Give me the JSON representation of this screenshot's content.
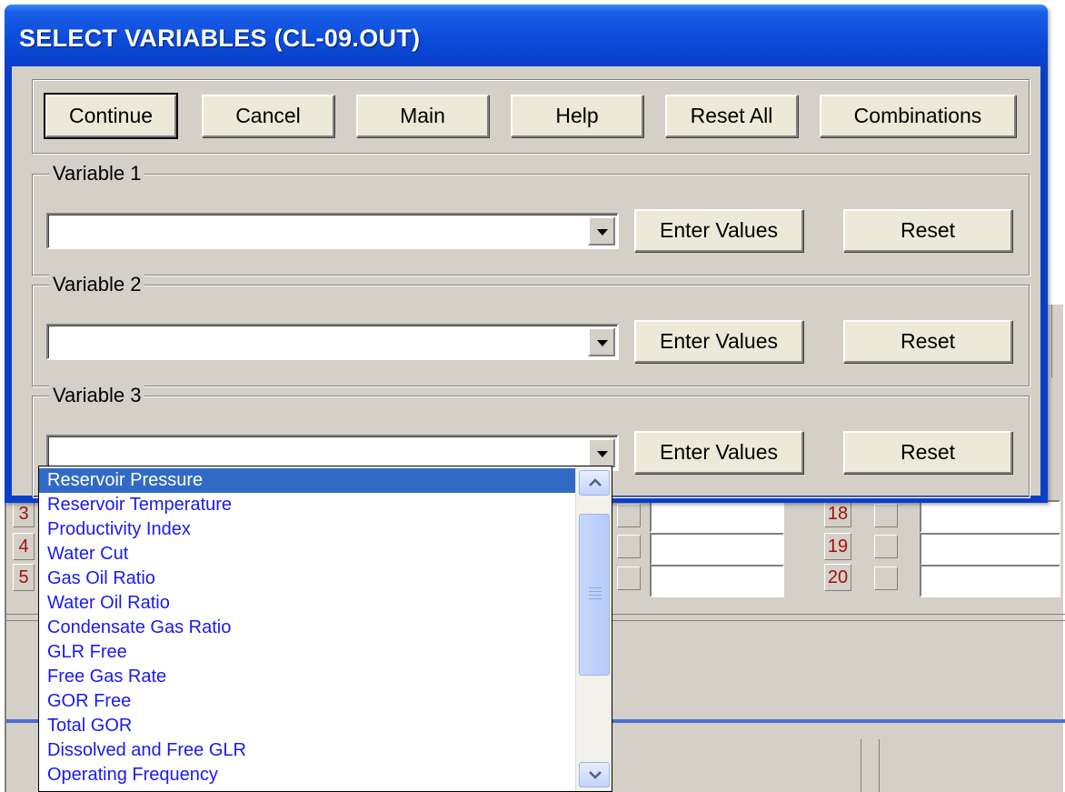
{
  "dialog": {
    "title": "SELECT VARIABLES (CL-09.OUT)",
    "buttons": {
      "continue": "Continue",
      "cancel": "Cancel",
      "main": "Main",
      "help": "Help",
      "reset_all": "Reset All",
      "combinations": "Combinations"
    },
    "variables": [
      {
        "label": "Variable 1",
        "value": "",
        "enter_values": "Enter Values",
        "reset": "Reset"
      },
      {
        "label": "Variable 2",
        "value": "",
        "enter_values": "Enter Values",
        "reset": "Reset"
      },
      {
        "label": "Variable 3",
        "value": "",
        "enter_values": "Enter Values",
        "reset": "Reset"
      }
    ]
  },
  "dropdown": {
    "selected_index": 0,
    "items": [
      "Reservoir Pressure",
      "Reservoir Temperature",
      "Productivity Index",
      "Water Cut",
      "Gas Oil Ratio",
      "Water Oil Ratio",
      "Condensate Gas Ratio",
      "GLR Free",
      "Free Gas Rate",
      "GOR Free",
      "Total GOR",
      "Dissolved and Free GLR",
      "Operating Frequency"
    ]
  },
  "background": {
    "row_numbers_left": [
      "3",
      "4",
      "5"
    ],
    "row_numbers_right": [
      "18",
      "19",
      "20"
    ]
  },
  "colors": {
    "title_bar": "#0b4ad8",
    "dialog_face": "#d4d0c8",
    "list_text": "#1a1af0",
    "list_selection": "#316ac5",
    "row_number_text": "#a01010"
  }
}
